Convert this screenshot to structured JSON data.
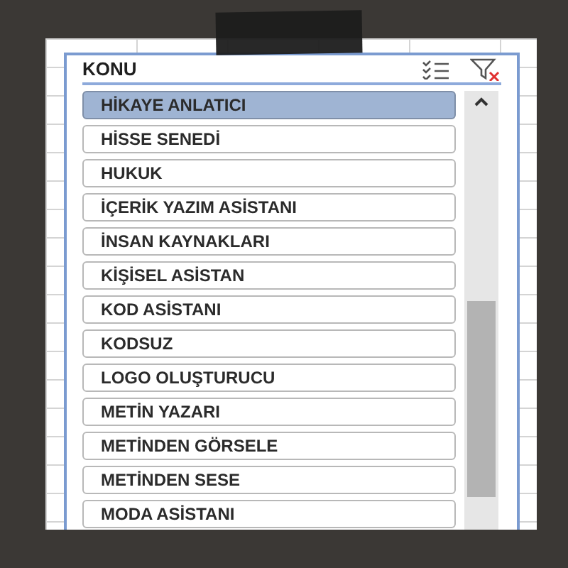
{
  "slicer": {
    "title": "KONU",
    "items": [
      {
        "label": "HİKAYE ANLATICI",
        "selected": true
      },
      {
        "label": "HİSSE SENEDİ",
        "selected": false
      },
      {
        "label": "HUKUK",
        "selected": false
      },
      {
        "label": "İÇERİK YAZIM ASİSTANI",
        "selected": false
      },
      {
        "label": "İNSAN KAYNAKLARI",
        "selected": false
      },
      {
        "label": "KİŞİSEL ASİSTAN",
        "selected": false
      },
      {
        "label": "KOD ASİSTANI",
        "selected": false
      },
      {
        "label": "KODSUZ",
        "selected": false
      },
      {
        "label": "LOGO OLUŞTURUCU",
        "selected": false
      },
      {
        "label": "METİN YAZARI",
        "selected": false
      },
      {
        "label": "METİNDEN GÖRSELE",
        "selected": false
      },
      {
        "label": "METİNDEN SESE",
        "selected": false
      },
      {
        "label": "MODA ASİSTANI",
        "selected": false
      }
    ]
  }
}
